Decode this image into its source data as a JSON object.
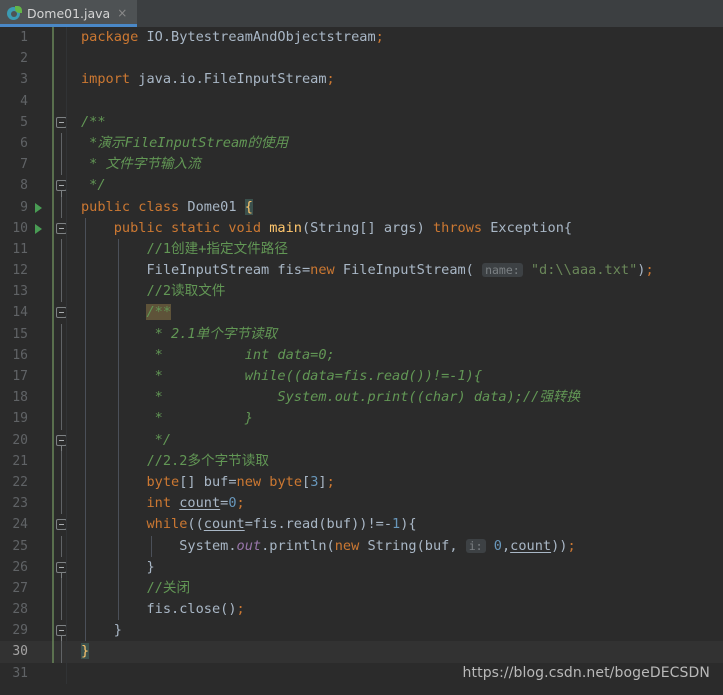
{
  "window": {
    "app": "IntelliJ IDEA Editor"
  },
  "tabs": [
    {
      "title": "Dome01.java",
      "icon": "java-class-icon",
      "close": "×",
      "active": true
    }
  ],
  "editor": {
    "language": "Java",
    "current_line": 30,
    "total_lines_visible": 31,
    "theme": "Darcula",
    "colors": {
      "background": "#2b2b2b",
      "current_line": "#323232",
      "keyword": "#cc7832",
      "string": "#6a8759",
      "number": "#6897bb",
      "comment": "#808080",
      "javadoc": "#629755",
      "method": "#ffc66d",
      "static_field": "#9876aa",
      "text": "#a9b7c6",
      "line_number": "#606366",
      "tab_underline": "#4a88c7",
      "vcs_change": "#6a8759",
      "brace_match_bg": "#3b514d",
      "identifier_highlight_bg": "#5e5339"
    },
    "lines": [
      {
        "n": 1,
        "text": "package IO.BytestreamAndObjectstream;"
      },
      {
        "n": 2,
        "text": ""
      },
      {
        "n": 3,
        "text": "import java.io.FileInputStream;"
      },
      {
        "n": 4,
        "text": ""
      },
      {
        "n": 5,
        "text": "/**"
      },
      {
        "n": 6,
        "text": " *演示FileInputStream的使用"
      },
      {
        "n": 7,
        "text": " * 文件字节输入流"
      },
      {
        "n": 8,
        "text": " */"
      },
      {
        "n": 9,
        "text": "public class Dome01 {"
      },
      {
        "n": 10,
        "text": "    public static void main(String[] args) throws Exception{"
      },
      {
        "n": 11,
        "text": "        //1创建+指定文件路径"
      },
      {
        "n": 12,
        "text": "        FileInputStream fis=new FileInputStream( name: \"d:\\\\aaa.txt\");"
      },
      {
        "n": 13,
        "text": "        //2读取文件"
      },
      {
        "n": 14,
        "text": "        /**"
      },
      {
        "n": 15,
        "text": "         * 2.1单个字节读取"
      },
      {
        "n": 16,
        "text": "         *          int data=0;"
      },
      {
        "n": 17,
        "text": "         *          while((data=fis.read())!=-1){"
      },
      {
        "n": 18,
        "text": "         *              System.out.print((char) data);//强转换"
      },
      {
        "n": 19,
        "text": "         *          }"
      },
      {
        "n": 20,
        "text": "         */"
      },
      {
        "n": 21,
        "text": "        //2.2多个字节读取"
      },
      {
        "n": 22,
        "text": "        byte[] buf=new byte[3];"
      },
      {
        "n": 23,
        "text": "        int count=0;"
      },
      {
        "n": 24,
        "text": "        while((count=fis.read(buf))!=-1){"
      },
      {
        "n": 25,
        "text": "            System.out.println(new String(buf, i: 0,count));"
      },
      {
        "n": 26,
        "text": "        }"
      },
      {
        "n": 27,
        "text": "        //关闭"
      },
      {
        "n": 28,
        "text": "        fis.close();"
      },
      {
        "n": 29,
        "text": "    }"
      },
      {
        "n": 30,
        "text": "}"
      },
      {
        "n": 31,
        "text": ""
      }
    ],
    "inlay_hints": [
      {
        "line": 12,
        "label": "name:"
      },
      {
        "line": 25,
        "label": "i:"
      }
    ],
    "run_gutter_lines": [
      9,
      10
    ],
    "keywords": [
      "package",
      "import",
      "public",
      "class",
      "static",
      "void",
      "throws",
      "new",
      "byte",
      "int",
      "while"
    ]
  },
  "watermark": {
    "text": "https://blog.csdn.net/bogeDECSDN"
  }
}
